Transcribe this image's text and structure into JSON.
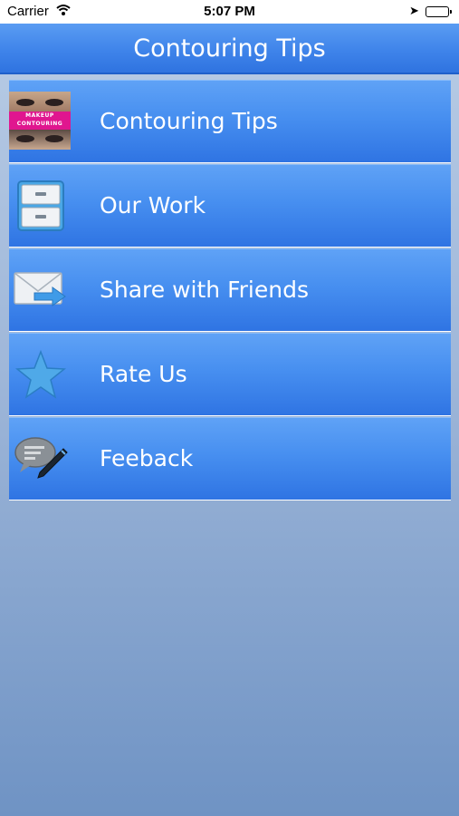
{
  "status_bar": {
    "carrier": "Carrier",
    "time": "5:07 PM"
  },
  "navbar": {
    "title": "Contouring Tips"
  },
  "thumbnail": {
    "line1": "MAKEUP",
    "line2": "CONTOURING"
  },
  "menu": [
    {
      "label": "Contouring Tips",
      "icon": "makeup-thumbnail-icon"
    },
    {
      "label": "Our Work",
      "icon": "cabinet-icon"
    },
    {
      "label": "Share with Friends",
      "icon": "mail-share-icon"
    },
    {
      "label": "Rate Us",
      "icon": "star-icon"
    },
    {
      "label": "Feeback",
      "icon": "chat-pen-icon"
    }
  ],
  "colors": {
    "navbar": "#3f84ea",
    "row": "#478ff0",
    "background": "#9fb7d9"
  }
}
